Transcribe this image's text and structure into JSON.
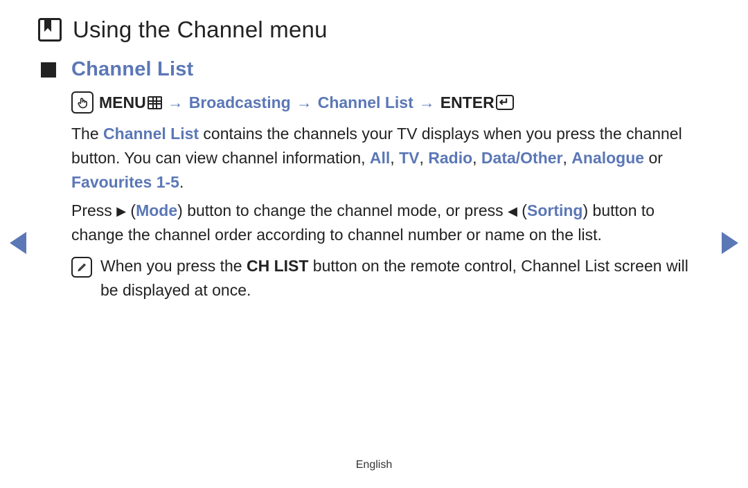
{
  "section_title": "Using the Channel menu",
  "item_title": "Channel List",
  "path": {
    "menu": "MENU",
    "arrow": "→",
    "broadcasting": "Broadcasting",
    "channel_list": "Channel List",
    "enter": "ENTER"
  },
  "p1": {
    "a": "The ",
    "channel_list": "Channel List",
    "b": " contains the channels your TV displays when you press the channel button. You can view channel information, ",
    "all": "All",
    "c1": ", ",
    "tv": "TV",
    "c2": ", ",
    "radio": "Radio",
    "c3": ", ",
    "data_other": "Data/Other",
    "c4": ", ",
    "analogue": "Analogue",
    "or": " or ",
    "favourites": "Favourites 1-5",
    "dot": "."
  },
  "p2": {
    "a": "Press ",
    "tri_r": "▶",
    "b": " (",
    "mode": "Mode",
    "c": ") button to change the channel mode, or press ",
    "tri_l": "◀",
    "d": " (",
    "sorting": "Sorting",
    "e": ") button to change the channel order according to channel number or name on the list."
  },
  "note": {
    "a": "When you press the ",
    "ch_list": "CH LIST",
    "b": " button on the remote control, ",
    "channel_list": "Channel List",
    "c": " screen will be displayed at once."
  },
  "footer_lang": "English"
}
